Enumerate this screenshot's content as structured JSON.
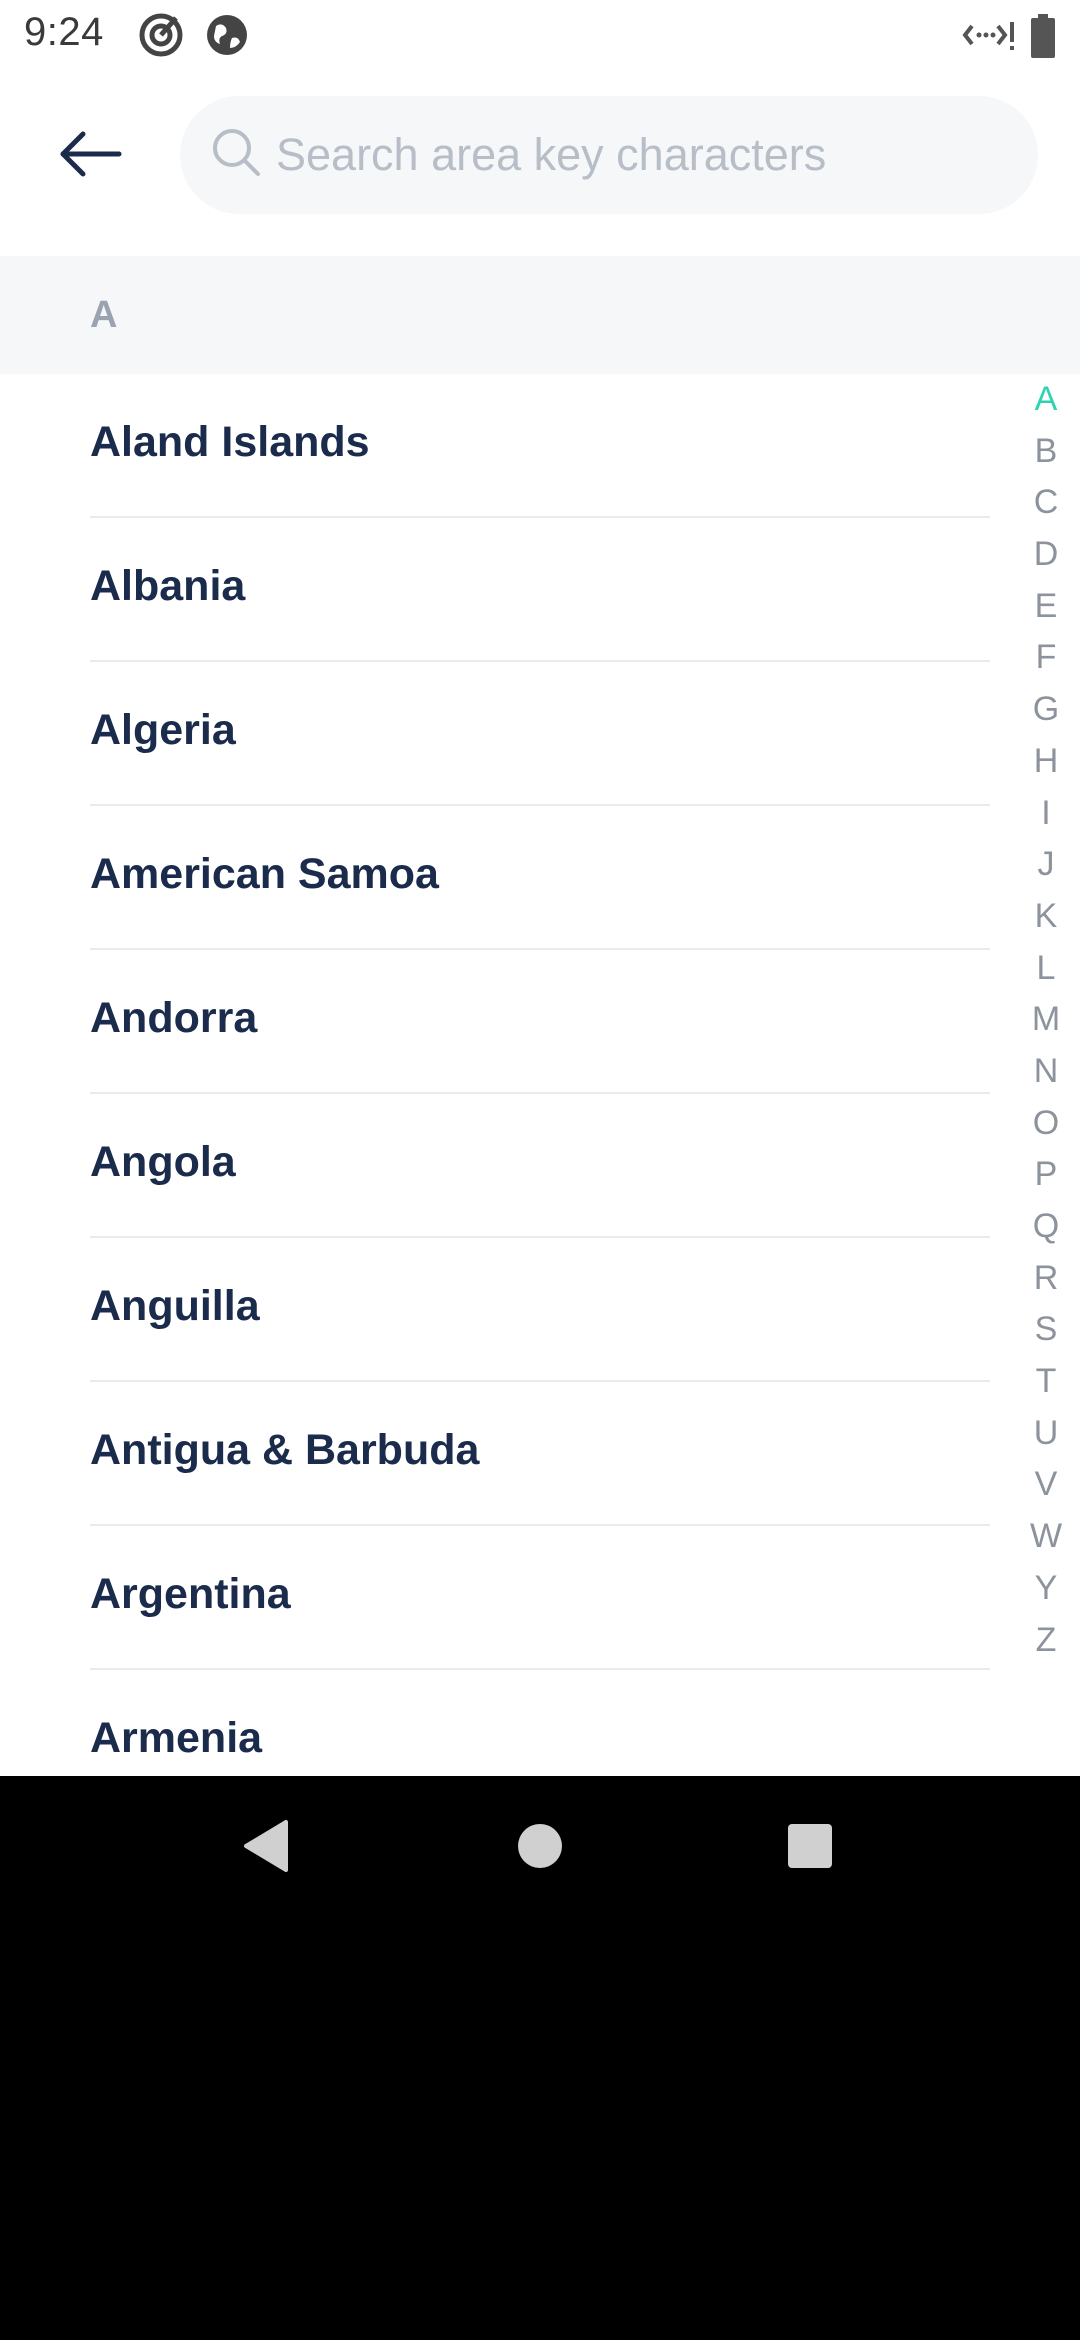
{
  "status_bar": {
    "time": "9:24",
    "left_icons": [
      "target-icon",
      "globe-icon"
    ],
    "right_icons": [
      "data-transfer-icon",
      "battery-icon"
    ]
  },
  "header": {
    "back_icon": "arrow-left-icon",
    "search": {
      "placeholder": "Search area key characters",
      "value": "",
      "icon": "search-icon"
    }
  },
  "section": {
    "letter": "A"
  },
  "countries": [
    {
      "name": "Aland Islands"
    },
    {
      "name": "Albania"
    },
    {
      "name": "Algeria"
    },
    {
      "name": "American Samoa"
    },
    {
      "name": "Andorra"
    },
    {
      "name": "Angola"
    },
    {
      "name": "Anguilla"
    },
    {
      "name": "Antigua & Barbuda"
    },
    {
      "name": "Argentina"
    },
    {
      "name": "Armenia"
    }
  ],
  "alpha_index": {
    "letters": [
      "A",
      "B",
      "C",
      "D",
      "E",
      "F",
      "G",
      "H",
      "I",
      "J",
      "K",
      "L",
      "M",
      "N",
      "O",
      "P",
      "Q",
      "R",
      "S",
      "T",
      "U",
      "V",
      "W",
      "Y",
      "Z"
    ],
    "active": "A"
  },
  "colors": {
    "accent": "#2ed3b0",
    "text_primary": "#1b2b4b",
    "text_muted": "#8c939c",
    "search_bg": "#f5f7f9"
  },
  "nav_bar": {
    "icons": [
      "back-triangle-icon",
      "home-circle-icon",
      "recents-square-icon"
    ]
  }
}
